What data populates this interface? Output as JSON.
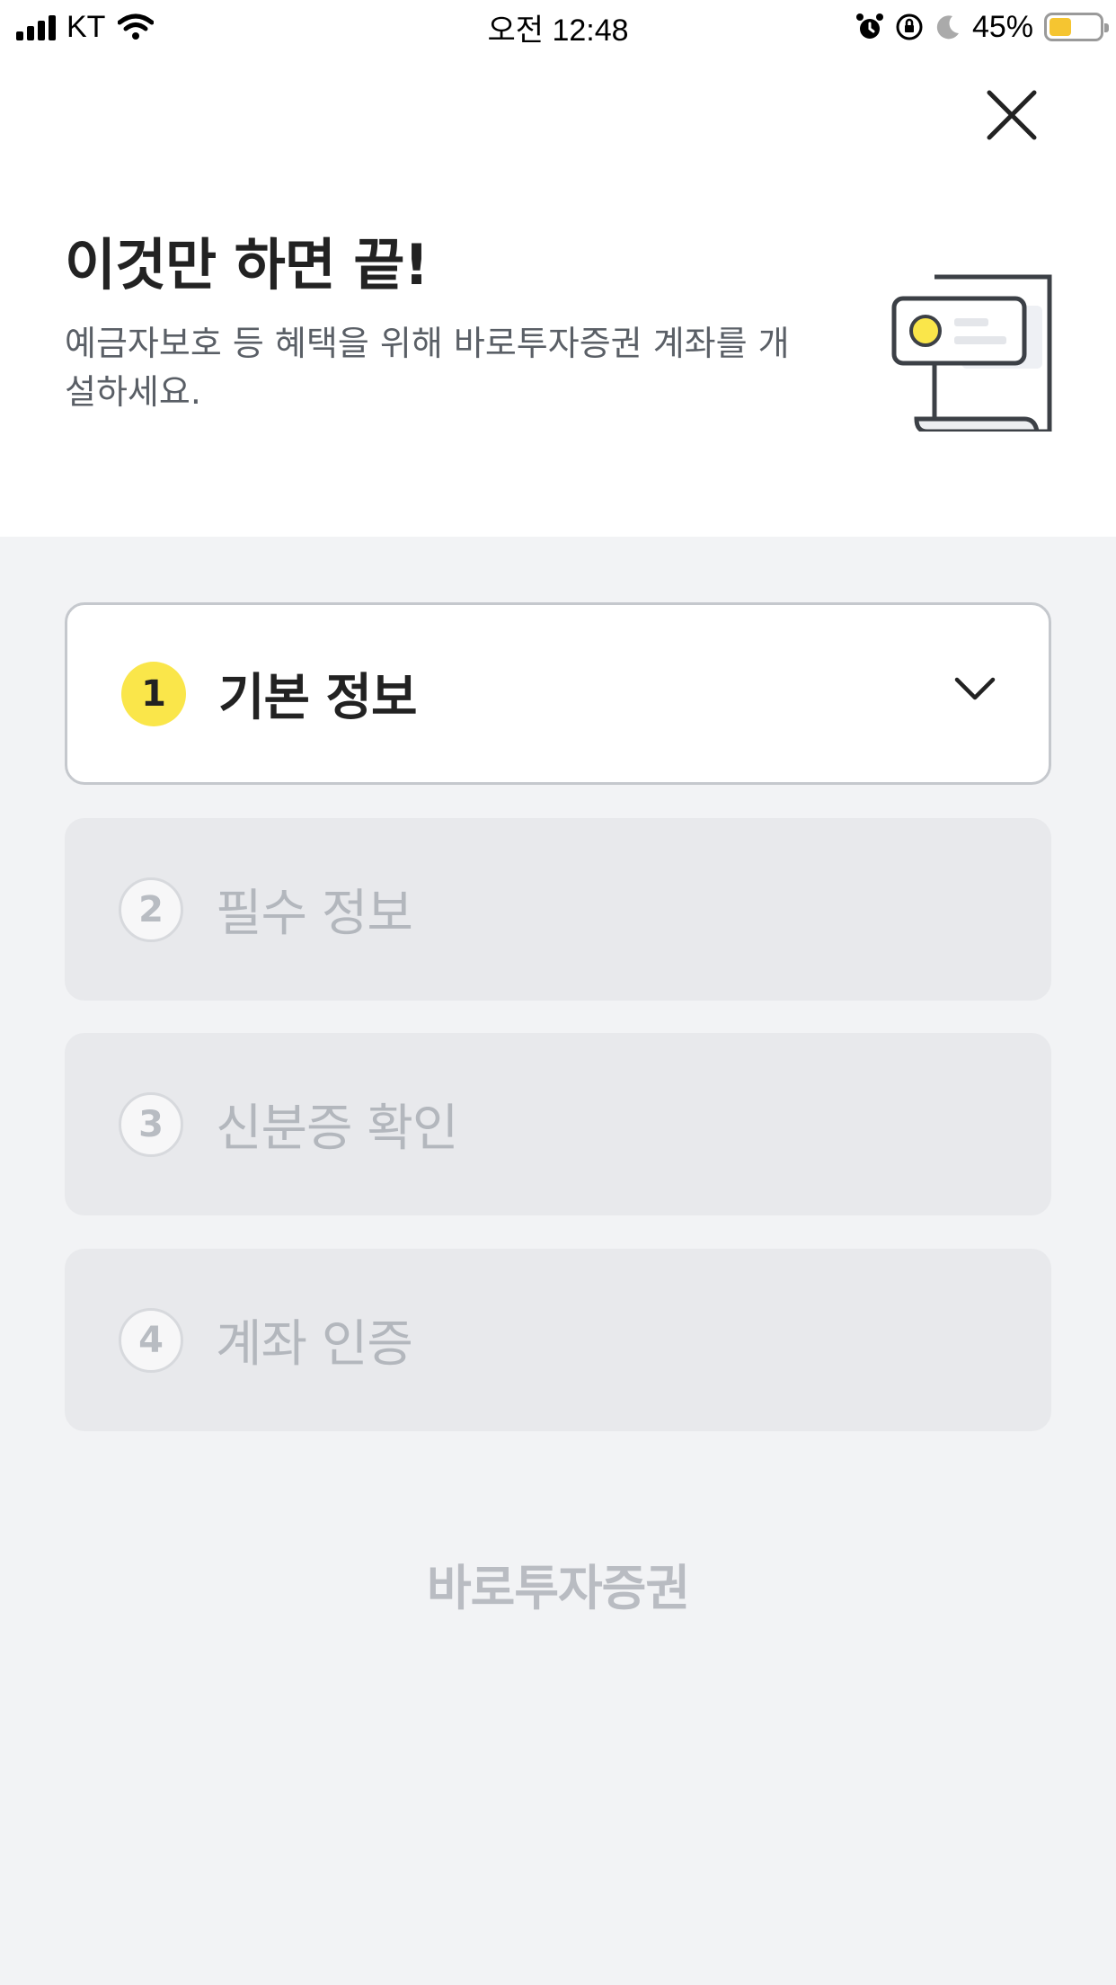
{
  "status_bar": {
    "carrier": "KT",
    "time": "오전 12:48",
    "battery_percent": "45%",
    "battery_level": 0.45,
    "icons": [
      "signal-icon",
      "wifi-icon",
      "alarm-icon",
      "rotation-lock-icon",
      "moon-icon",
      "battery-icon"
    ]
  },
  "header": {
    "close_icon": "close-icon",
    "title": "이것만 하면 끝!",
    "subtitle": "예금자보호 등 혜택을 위해 바로투자증권 계좌를 개설하세요.",
    "illustration": "document-card-icon"
  },
  "steps": [
    {
      "number": "1",
      "label": "기본 정보",
      "state": "active"
    },
    {
      "number": "2",
      "label": "필수 정보",
      "state": "disabled"
    },
    {
      "number": "3",
      "label": "신분증 확인",
      "state": "disabled"
    },
    {
      "number": "4",
      "label": "계좌 인증",
      "state": "disabled"
    }
  ],
  "footer": {
    "brand": "바로투자증권"
  },
  "colors": {
    "accent_yellow": "#fae64a",
    "background": "#f2f3f5",
    "disabled_card": "#e8e9ec",
    "disabled_text": "#b3b7bd"
  }
}
